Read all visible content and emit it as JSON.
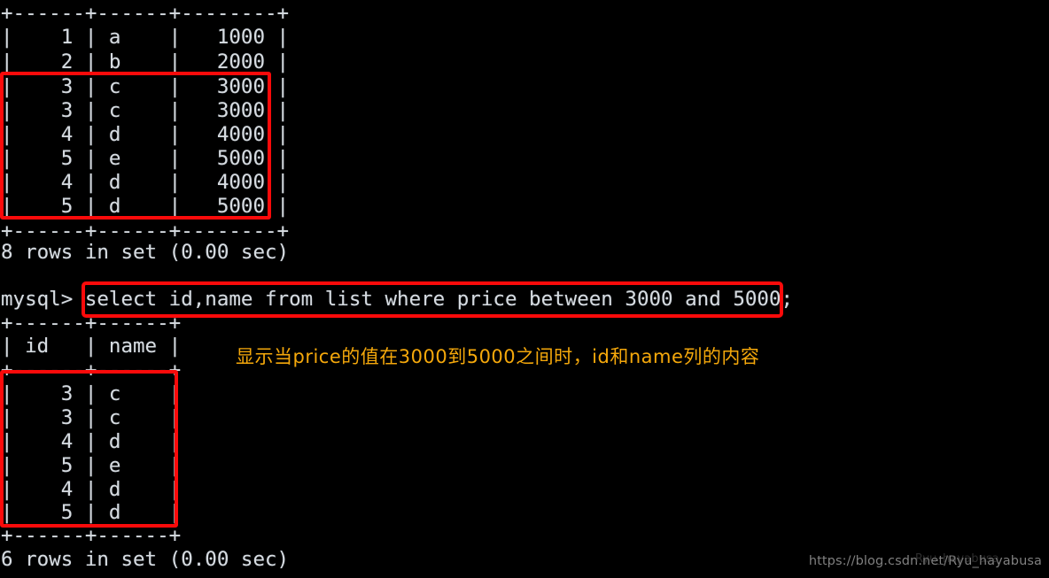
{
  "terminal": {
    "background_color": "#000000",
    "text_color": "#d6dbe0",
    "prompt": "mysql> ",
    "lines": [
      "+------+------+--------+",
      "|    1 | a    |   1000 |",
      "|    2 | b    |   2000 |",
      "|    3 | c    |   3000 |",
      "|    3 | c    |   3000 |",
      "|    4 | d    |   4000 |",
      "|    5 | e    |   5000 |",
      "|    4 | d    |   4000 |",
      "|    5 | d    |   5000 |",
      "+------+------+--------+",
      "8 rows in set (0.00 sec)",
      "",
      "mysql> select id,name from list where price between 3000 and 5000;",
      "+------+------+",
      "| id   | name |",
      "+------+------+",
      "|    3 | c    |",
      "|    3 | c    |",
      "|    4 | d    |",
      "|    5 | e    |",
      "|    4 | d    |",
      "|    5 | d    |",
      "+------+------+",
      "6 rows in set (0.00 sec)"
    ]
  },
  "first_result": {
    "separator": "+------+------+--------+",
    "rows": [
      "|    1 | a    |   1000 |",
      "|    2 | b    |   2000 |",
      "|    3 | c    |   3000 |",
      "|    3 | c    |   3000 |",
      "|    4 | d    |   4000 |",
      "|    5 | e    |   5000 |",
      "|    4 | d    |   4000 |",
      "|    5 | d    |   5000 |"
    ],
    "status": "8 rows in set (0.00 sec)",
    "row_count": 8,
    "columns": [
      "id",
      "name",
      "price"
    ],
    "data": [
      {
        "id": 1,
        "name": "a",
        "price": 1000
      },
      {
        "id": 2,
        "name": "b",
        "price": 2000
      },
      {
        "id": 3,
        "name": "c",
        "price": 3000
      },
      {
        "id": 3,
        "name": "c",
        "price": 3000
      },
      {
        "id": 4,
        "name": "d",
        "price": 4000
      },
      {
        "id": 5,
        "name": "e",
        "price": 5000
      },
      {
        "id": 4,
        "name": "d",
        "price": 4000
      },
      {
        "id": 5,
        "name": "d",
        "price": 5000
      }
    ]
  },
  "command": {
    "prompt": "mysql>",
    "sql": "select id,name from list where price between 3000 and 5000;"
  },
  "second_result": {
    "separator": "+------+------+",
    "header": "| id   | name |",
    "rows": [
      "|    3 | c    |",
      "|    3 | c    |",
      "|    4 | d    |",
      "|    5 | e    |",
      "|    4 | d    |",
      "|    5 | d    |"
    ],
    "status": "6 rows in set (0.00 sec)",
    "row_count": 6,
    "columns": [
      "id",
      "name"
    ],
    "data": [
      {
        "id": 3,
        "name": "c"
      },
      {
        "id": 3,
        "name": "c"
      },
      {
        "id": 4,
        "name": "d"
      },
      {
        "id": 5,
        "name": "e"
      },
      {
        "id": 4,
        "name": "d"
      },
      {
        "id": 5,
        "name": "d"
      }
    ]
  },
  "annotations": {
    "box_color": "#fb0a0a",
    "note_color": "#f5a80b",
    "note_text": "显示当price的值在3000到5000之间时，id和name列的内容",
    "box_labels": {
      "first_rows": "highlight-first-result-matching-rows",
      "sql": "highlight-sql-command",
      "second_rows": "highlight-second-result-rows"
    }
  },
  "watermark": {
    "text": "https://blog.csdn.net/Ryu_hayabusa",
    "ghost": "Ryu_hayabusa"
  }
}
